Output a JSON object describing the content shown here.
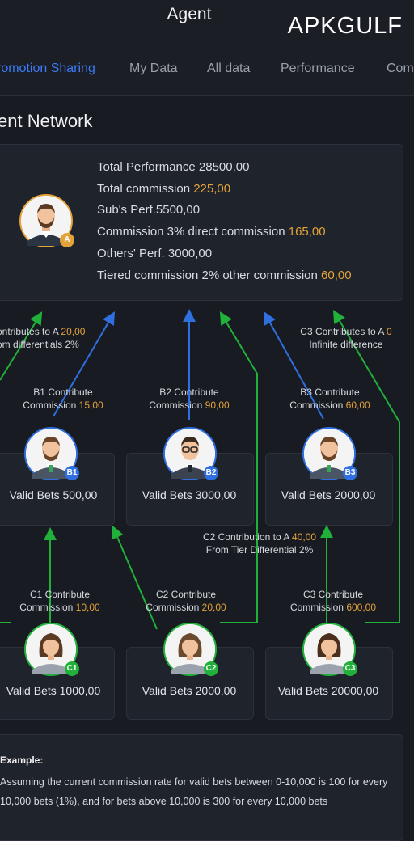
{
  "header": {
    "title": "Agent",
    "watermark": "APKGULF"
  },
  "tabs": [
    {
      "label": "romotion Sharing",
      "active": true
    },
    {
      "label": "My Data"
    },
    {
      "label": "All data"
    },
    {
      "label": "Performance"
    },
    {
      "label": "Com"
    }
  ],
  "section_title": "ent Network",
  "agent_a": {
    "badge": "A",
    "stats": [
      {
        "label": "Total Performance 28500,00",
        "value": ""
      },
      {
        "label": "Total commission ",
        "value": "225,00"
      },
      {
        "label": "Sub's Perf.5500,00",
        "value": ""
      },
      {
        "label": "Commission 3% direct commission ",
        "value": "165,00"
      },
      {
        "label": "Others' Perf. 3000,00",
        "value": ""
      },
      {
        "label": "Tiered commission 2% other commission ",
        "value": "60,00"
      }
    ]
  },
  "annotations": {
    "b1_to_a_l1": "ontributes to A ",
    "b1_to_a_val": "20,00",
    "b1_to_a_l2": "om differentials 2%",
    "c3_to_a_l1": "C3 Contributes to A ",
    "c3_to_a_val": "0",
    "c3_to_a_l2": "Infinite difference",
    "c2_to_a_l1": "C2 Contribution to A ",
    "c2_to_a_val": "40,00",
    "c2_to_a_l2": "From Tier Differential 2%"
  },
  "level_b": [
    {
      "badge": "B1",
      "contrib_l1": "B1 Contribute",
      "contrib_l2": "Commission ",
      "commission": "15,00",
      "bets": "Valid Bets 500,00"
    },
    {
      "badge": "B2",
      "contrib_l1": "B2 Contribute",
      "contrib_l2": "Commission ",
      "commission": "90,00",
      "bets": "Valid Bets 3000,00"
    },
    {
      "badge": "B3",
      "contrib_l1": "B3 Contribute",
      "contrib_l2": "Commission ",
      "commission": "60,00",
      "bets": "Valid Bets 2000,00"
    }
  ],
  "level_c": [
    {
      "badge": "C1",
      "contrib_l1": "C1 Contribute",
      "contrib_l2": "Commission ",
      "commission": "10,00",
      "bets": "Valid Bets 1000,00"
    },
    {
      "badge": "C2",
      "contrib_l1": "C2 Contribute",
      "contrib_l2": "Commission ",
      "commission": "20,00",
      "bets": "Valid Bets 2000,00"
    },
    {
      "badge": "C3",
      "contrib_l1": "C3 Contribute",
      "contrib_l2": "Commission ",
      "commission": "600,00",
      "bets": "Valid Bets 20000,00"
    }
  ],
  "example": {
    "title": "Example:",
    "text": "Assuming the current commission rate for valid bets between 0-10,000 is 100 for every 10,000 bets (1%), and for bets above 10,000 is 300 for every 10,000 bets"
  },
  "colors": {
    "accent": "#3b7bf6",
    "gold": "#e3a23a",
    "green": "#21b13a",
    "blue": "#2f6fe0",
    "background": "#181b22"
  }
}
